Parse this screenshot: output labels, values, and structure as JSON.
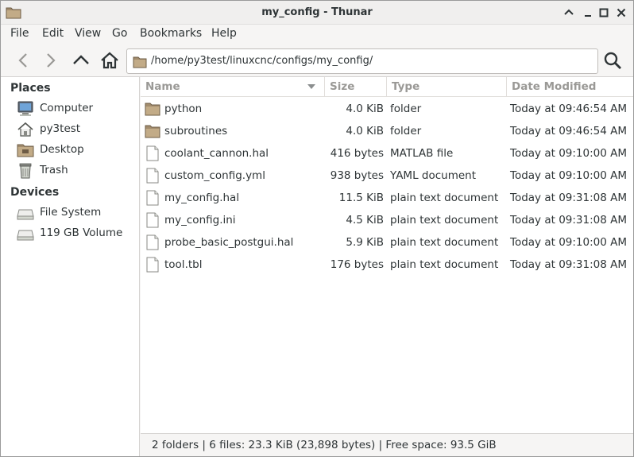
{
  "window": {
    "title": "my_config - Thunar"
  },
  "menu": [
    "File",
    "Edit",
    "View",
    "Go",
    "Bookmarks",
    "Help"
  ],
  "toolbar": {
    "path": "/home/py3test/linuxcnc/configs/my_config/"
  },
  "sidebar": {
    "places_heading": "Places",
    "places": [
      {
        "label": "Computer",
        "icon": "computer-icon"
      },
      {
        "label": "py3test",
        "icon": "home-icon"
      },
      {
        "label": "Desktop",
        "icon": "desktop-folder-icon"
      },
      {
        "label": "Trash",
        "icon": "trash-icon"
      }
    ],
    "devices_heading": "Devices",
    "devices": [
      {
        "label": "File System",
        "icon": "drive-icon"
      },
      {
        "label": "119 GB Volume",
        "icon": "drive-icon"
      }
    ]
  },
  "columns": {
    "name": "Name",
    "size": "Size",
    "type": "Type",
    "date": "Date Modified"
  },
  "files": [
    {
      "name": "python",
      "size": "4.0 KiB",
      "type": "folder",
      "date": "Today at 09:46:54 AM",
      "kind": "folder"
    },
    {
      "name": "subroutines",
      "size": "4.0 KiB",
      "type": "folder",
      "date": "Today at 09:46:54 AM",
      "kind": "folder"
    },
    {
      "name": "coolant_cannon.hal",
      "size": "416 bytes",
      "type": "MATLAB file",
      "date": "Today at 09:10:00 AM",
      "kind": "file"
    },
    {
      "name": "custom_config.yml",
      "size": "938 bytes",
      "type": "YAML document",
      "date": "Today at 09:10:00 AM",
      "kind": "file"
    },
    {
      "name": "my_config.hal",
      "size": "11.5 KiB",
      "type": "plain text document",
      "date": "Today at 09:31:08 AM",
      "kind": "file"
    },
    {
      "name": "my_config.ini",
      "size": "4.5 KiB",
      "type": "plain text document",
      "date": "Today at 09:31:08 AM",
      "kind": "file"
    },
    {
      "name": "probe_basic_postgui.hal",
      "size": "5.9 KiB",
      "type": "plain text document",
      "date": "Today at 09:10:00 AM",
      "kind": "file"
    },
    {
      "name": "tool.tbl",
      "size": "176 bytes",
      "type": "plain text document",
      "date": "Today at 09:31:08 AM",
      "kind": "file"
    }
  ],
  "status": {
    "text": "2 folders  |  6 files: 23.3 KiB (23,898 bytes)  |  Free space: 93.5 GiB"
  }
}
